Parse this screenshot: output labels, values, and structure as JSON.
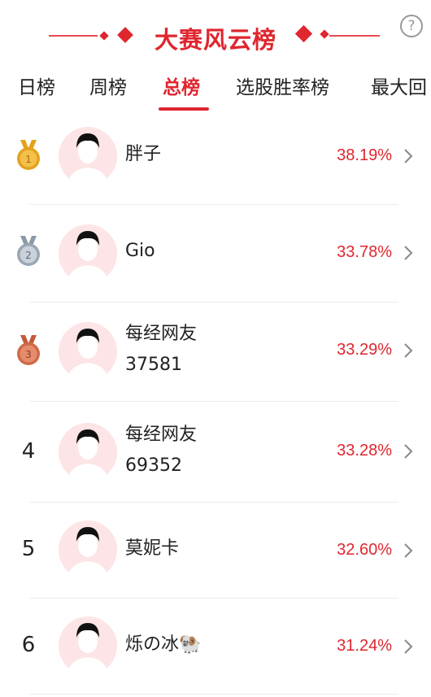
{
  "header": {
    "title": "大赛风云榜",
    "help_glyph": "?"
  },
  "tabs": [
    {
      "label": "日榜",
      "active": false
    },
    {
      "label": "周榜",
      "active": false
    },
    {
      "label": "总榜",
      "active": true
    },
    {
      "label": "选股胜率榜",
      "active": false
    },
    {
      "label": "最大回",
      "active": false
    }
  ],
  "rows": [
    {
      "rank": "1",
      "medal": "gold",
      "name": [
        "胖子"
      ],
      "pct": "38.19%"
    },
    {
      "rank": "2",
      "medal": "silver",
      "name": [
        "Gio"
      ],
      "pct": "33.78%"
    },
    {
      "rank": "3",
      "medal": "bronze",
      "name": [
        "每经网友",
        "37581"
      ],
      "pct": "33.29%"
    },
    {
      "rank": "4",
      "medal": null,
      "name": [
        "每经网友",
        "69352"
      ],
      "pct": "33.28%"
    },
    {
      "rank": "5",
      "medal": null,
      "name": [
        "莫妮卡"
      ],
      "pct": "32.60%"
    },
    {
      "rank": "6",
      "medal": null,
      "name": [
        "烁の冰🐏"
      ],
      "pct": "31.24%"
    }
  ],
  "colors": {
    "accent": "#e0262f",
    "avatar_bg": "#fde4e6",
    "gold": "#e3a21f",
    "silver": "#9aa6b4",
    "bronze": "#cf6a48"
  }
}
